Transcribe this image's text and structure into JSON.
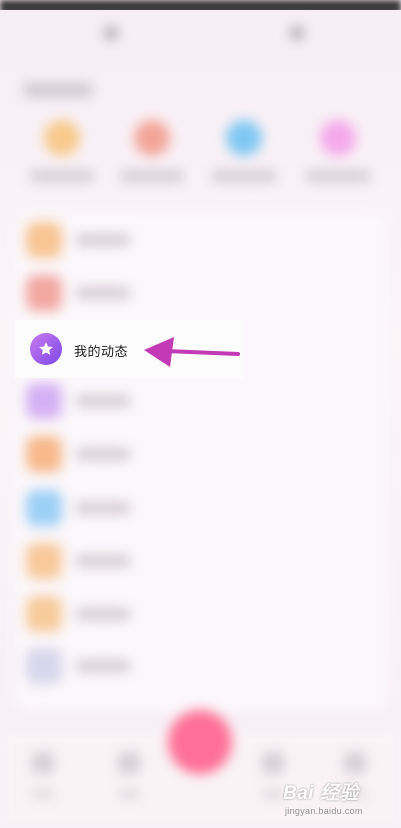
{
  "highlighted_item": {
    "label": "我的动态",
    "icon": "star-icon"
  },
  "colors": {
    "accent_arrow": "#c23ab5",
    "badge_start": "#c77bf1",
    "badge_end": "#7d47e6",
    "center_button": "#ff6f97"
  },
  "quick_actions_icons": [
    "#f8c98b",
    "#f3a497",
    "#7fc8f3",
    "#f5a8ea"
  ],
  "menu_icons": [
    "#f9c592",
    "#f3a7a1",
    "#d6b0f4",
    "#f8b98b",
    "#9dd0f6",
    "#f9c99a",
    "#f8cb9b",
    "#d7d6ec"
  ],
  "watermark": {
    "brand": "Bai 经验",
    "url": "jingyan.baidu.com"
  }
}
